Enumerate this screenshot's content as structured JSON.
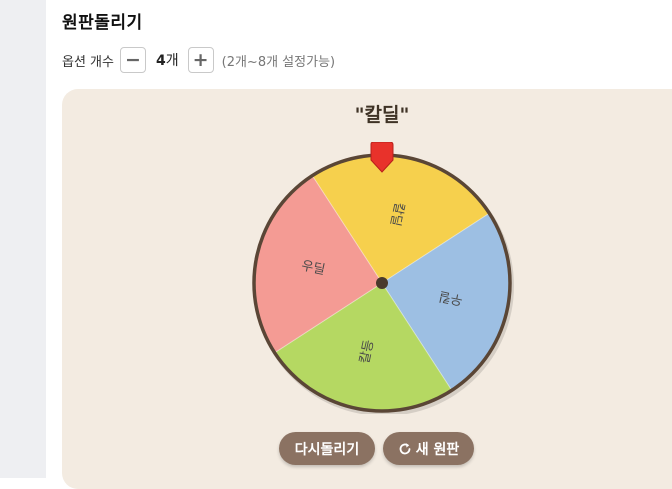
{
  "title": "원판돌리기",
  "options": {
    "label": "옵션 개수",
    "count": "4",
    "unit": "개",
    "hint": "(2개~8개 설정가능)",
    "minus_symbol": "−",
    "plus_symbol": "+"
  },
  "result": "\"칼딜\"",
  "wheel": {
    "segments": [
      {
        "label": "칼딜",
        "color": "#f6d04d"
      },
      {
        "label": "우킬",
        "color": "#9dbfe3"
      },
      {
        "label": "칼등",
        "color": "#b5d862"
      },
      {
        "label": "우딜",
        "color": "#f49b94"
      }
    ],
    "rim_color": "#5a4636",
    "pointer_color": "#e8322b"
  },
  "buttons": {
    "spin_again": "다시돌리기",
    "new_wheel": "새 원판",
    "new_icon": "refresh-icon"
  }
}
